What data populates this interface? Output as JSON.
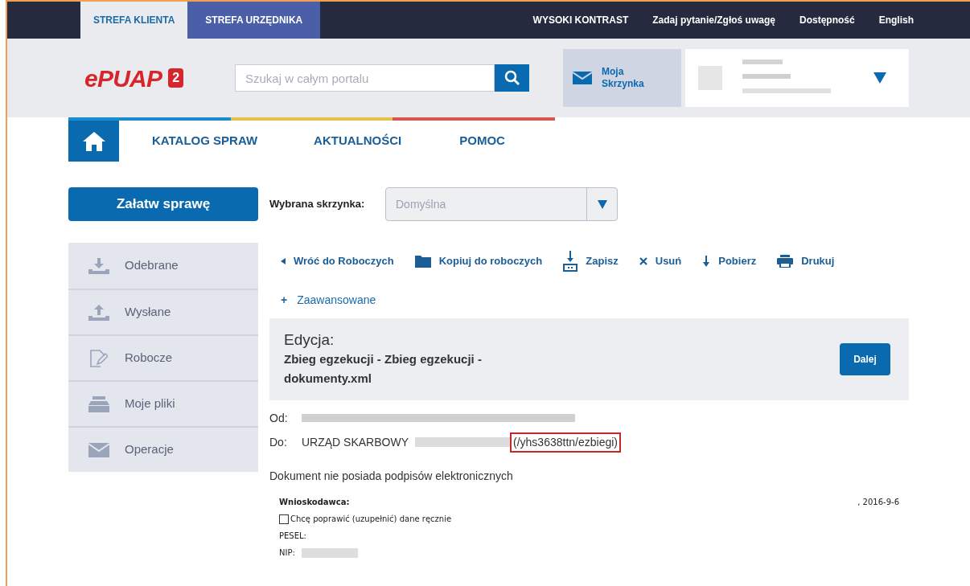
{
  "top_bar": {
    "zones": [
      {
        "label": "STREFA KLIENTA",
        "selected": true
      },
      {
        "label": "STREFA URZĘDNIKA",
        "selected": false
      }
    ],
    "links": [
      "WYSOKI KONTRAST",
      "Zadaj pytanie/Zgłoś uwagę",
      "Dostępność",
      "English"
    ]
  },
  "header": {
    "logo": "ePUAP",
    "logo_badge": "2",
    "search": {
      "placeholder": "Szukaj w całym portalu"
    },
    "mailbox": "Moja Skrzynka"
  },
  "nav": {
    "items": [
      "KATALOG SPRAW",
      "AKTUALNOŚCI",
      "POMOC"
    ]
  },
  "sidebar": {
    "button": "Załatw sprawę",
    "items": [
      {
        "kind": "inbox",
        "label": "Odebrane"
      },
      {
        "kind": "outbox",
        "label": "Wysłane"
      },
      {
        "kind": "drafts",
        "label": "Robocze"
      },
      {
        "kind": "files",
        "label": "Moje pliki"
      },
      {
        "kind": "mail",
        "label": "Operacje"
      }
    ]
  },
  "mailbox_select": {
    "label": "Wybrana skrzynka:",
    "value": "Domyślna"
  },
  "toolbar": [
    {
      "kind": "back",
      "label": "Wróć do Roboczych"
    },
    {
      "kind": "folder",
      "label": "Kopiuj do roboczych"
    },
    {
      "kind": "save",
      "label": "Zapisz"
    },
    {
      "kind": "delete",
      "label": "Usuń"
    },
    {
      "kind": "download",
      "label": "Pobierz"
    },
    {
      "kind": "print",
      "label": "Drukuj"
    }
  ],
  "advanced": {
    "icon": "+",
    "label": "Zaawansowane"
  },
  "edit_panel": {
    "heading": "Edycja:",
    "document": "Zbieg egzekucji - Zbieg egzekucji - dokumenty.xml",
    "button": "Dalej"
  },
  "from": {
    "label": "Od:"
  },
  "to": {
    "label": "Do:",
    "name": "URZĄD SKARBOWY",
    "address": "(/yhs3638ttn/ezbiegi)"
  },
  "signature_note": "Dokument nie posiada podpisów elektronicznych",
  "form": {
    "section": "Wnioskodawca:",
    "date": ", 2016-9-6",
    "checkbox": {
      "label": "Chcę poprawić (uzupełnić) dane ręcznie",
      "checked": false
    },
    "fields": [
      "PESEL:",
      "NIP:"
    ]
  }
}
